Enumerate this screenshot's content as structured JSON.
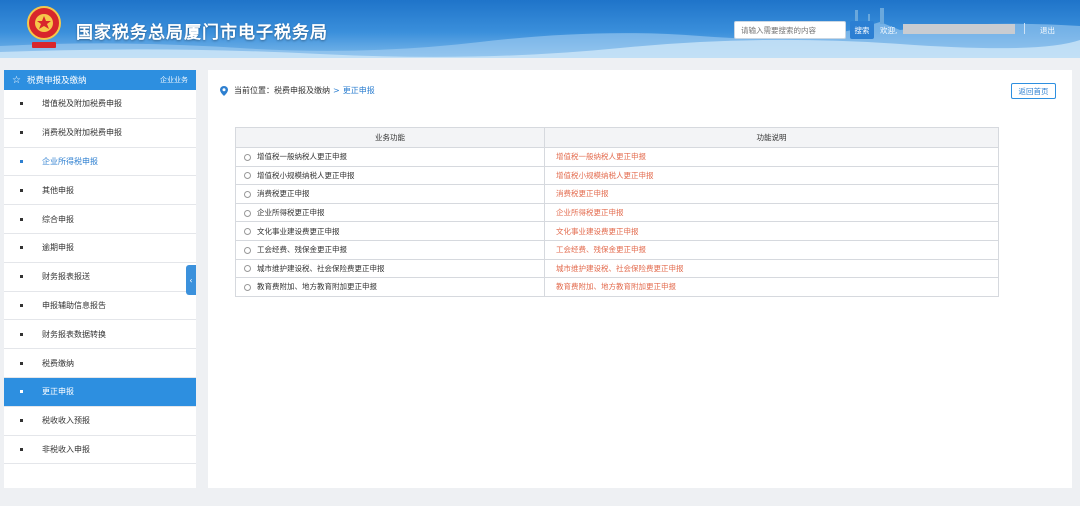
{
  "header": {
    "site_title": "国家税务总局厦门市电子税务局",
    "search_placeholder": "请输入需要搜索的内容",
    "search_button": "搜索",
    "welcome": "欢迎,",
    "logout": "退出"
  },
  "sidebar": {
    "title": "税费申报及缴纳",
    "subtitle": "企业业务",
    "items": [
      "增值税及附加税费申报",
      "消费税及附加税费申报",
      "企业所得税申报",
      "其他申报",
      "综合申报",
      "逾期申报",
      "财务报表报送",
      "申报辅助信息报告",
      "财务报表数据转换",
      "税费缴纳",
      "更正申报",
      "税收收入预报",
      "非税收入申报"
    ],
    "highlight_index": 2,
    "active_index": 10
  },
  "breadcrumb": {
    "label": "当前位置：",
    "parent": "税费申报及缴纳",
    "arrow": ">",
    "current": "更正申报"
  },
  "home_button": "返回首页",
  "table": {
    "headers": [
      "业务功能",
      "功能说明"
    ],
    "rows": [
      {
        "name": "增值税一般纳税人更正申报",
        "desc": "增值税一般纳税人更正申报"
      },
      {
        "name": "增值税小规模纳税人更正申报",
        "desc": "增值税小规模纳税人更正申报"
      },
      {
        "name": "消费税更正申报",
        "desc": "消费税更正申报"
      },
      {
        "name": "企业所得税更正申报",
        "desc": "企业所得税更正申报"
      },
      {
        "name": "文化事业建设费更正申报",
        "desc": "文化事业建设费更正申报"
      },
      {
        "name": "工会经费、残保金更正申报",
        "desc": "工会经费、残保金更正申报"
      },
      {
        "name": "城市维护建设税、社会保险费更正申报",
        "desc": "城市维护建设税、社会保险费更正申报"
      },
      {
        "name": "教育费附加、地方教育附加更正申报",
        "desc": "教育费附加、地方教育附加更正申报"
      }
    ]
  },
  "colors": {
    "accent": "#2d8fe0",
    "desc_text": "#e36b4e"
  }
}
